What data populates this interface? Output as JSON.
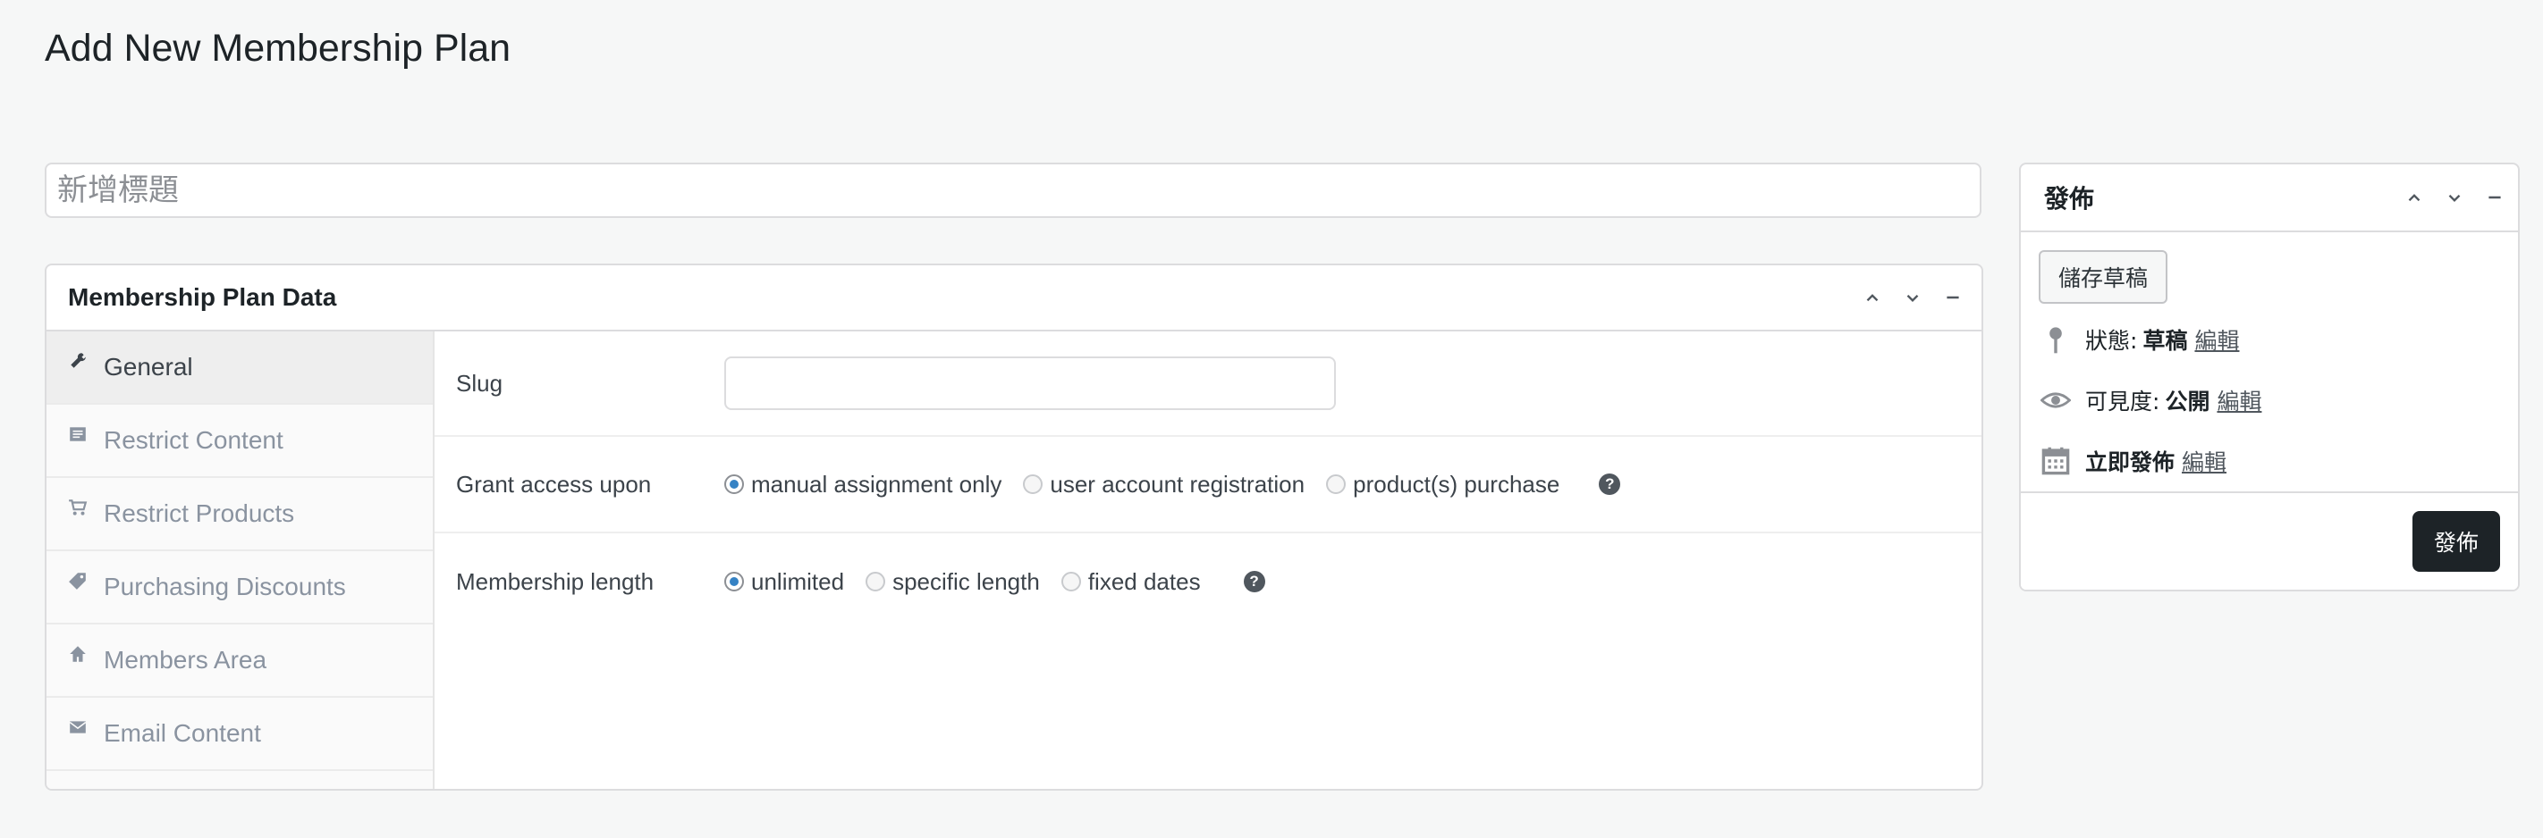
{
  "page": {
    "title": "Add New Membership Plan"
  },
  "title_field": {
    "placeholder": "新增標題",
    "value": ""
  },
  "membership_box": {
    "title": "Membership Plan Data",
    "tabs": [
      {
        "label": "General",
        "icon": "wrench-icon",
        "active": true
      },
      {
        "label": "Restrict Content",
        "icon": "page-icon"
      },
      {
        "label": "Restrict Products",
        "icon": "cart-icon"
      },
      {
        "label": "Purchasing Discounts",
        "icon": "tag-icon"
      },
      {
        "label": "Members Area",
        "icon": "home-icon"
      },
      {
        "label": "Email Content",
        "icon": "email-icon"
      }
    ],
    "slug": {
      "label": "Slug",
      "value": ""
    },
    "grant_access": {
      "label": "Grant access upon",
      "options": [
        "manual assignment only",
        "user account registration",
        "product(s) purchase"
      ],
      "selected": "manual assignment only"
    },
    "membership_length": {
      "label": "Membership length",
      "options": [
        "unlimited",
        "specific length",
        "fixed dates"
      ],
      "selected": "unlimited"
    },
    "help_icon": "?"
  },
  "publish_box": {
    "title": "發佈",
    "save_draft": "儲存草稿",
    "status": {
      "label": "狀態:",
      "value": "草稿",
      "edit": "編輯"
    },
    "visibility": {
      "label": "可見度:",
      "value": "公開",
      "edit": "編輯"
    },
    "schedule": {
      "label": "立即發佈",
      "edit": "編輯"
    },
    "publish_button": "發佈"
  },
  "colors": {
    "accent": "#3582c4",
    "publish_button": "#1d2327"
  }
}
